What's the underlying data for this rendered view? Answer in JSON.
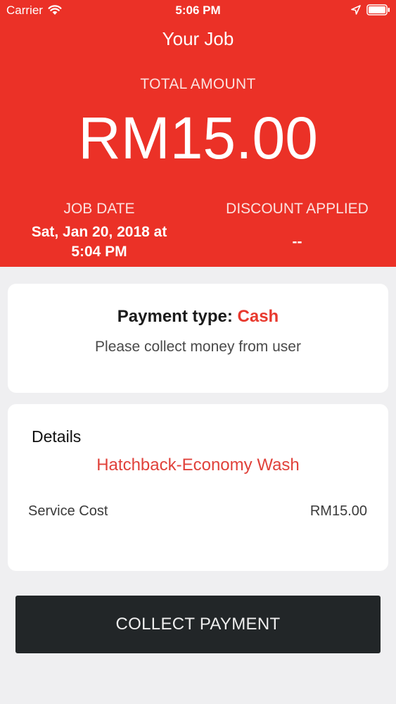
{
  "status_bar": {
    "carrier": "Carrier",
    "time": "5:06 PM",
    "icons": [
      "wifi-icon",
      "location-icon",
      "battery-icon"
    ]
  },
  "header": {
    "title": "Your Job",
    "total_label": "TOTAL AMOUNT",
    "total_amount": "RM15.00",
    "job_date_label": "JOB DATE",
    "job_date_line1": "Sat, Jan 20, 2018 at",
    "job_date_line2": "5:04 PM",
    "discount_label": "DISCOUNT APPLIED",
    "discount_value": "--"
  },
  "payment_card": {
    "type_label": "Payment type:",
    "type_value": "Cash",
    "note": "Please collect money from user"
  },
  "details_card": {
    "heading": "Details",
    "service_name": "Hatchback-Economy Wash",
    "cost_label": "Service Cost",
    "cost_value": "RM15.00"
  },
  "actions": {
    "collect_label": "COLLECT PAYMENT"
  },
  "colors": {
    "header_red": "#eb3127",
    "accent_red": "#e8392e",
    "button_dark": "#222628",
    "background": "#efeff1"
  }
}
